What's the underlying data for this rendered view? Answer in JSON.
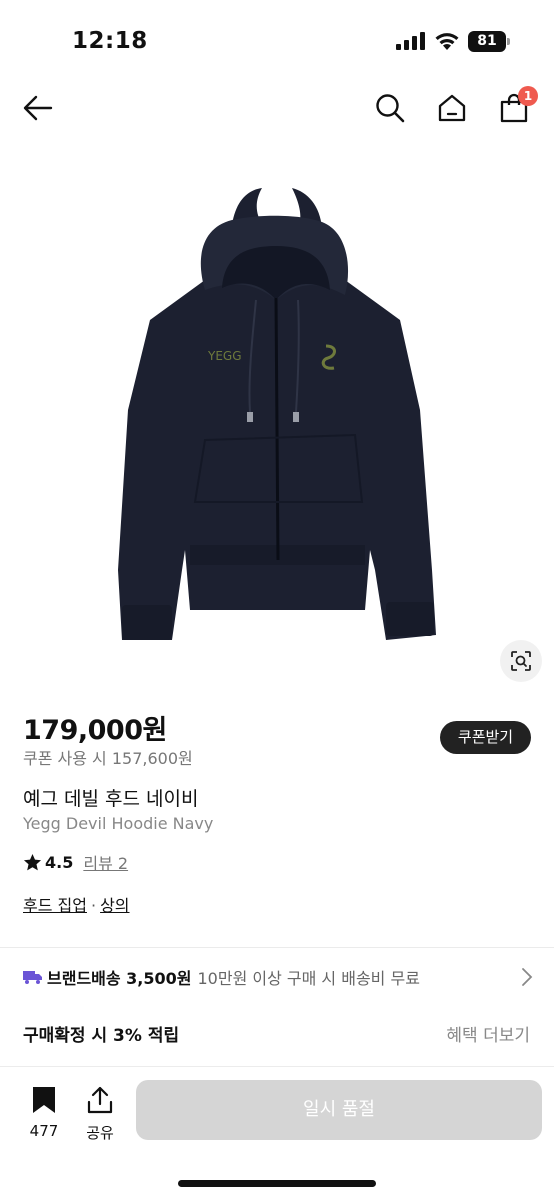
{
  "status_bar": {
    "time": "12:18",
    "battery": "81"
  },
  "nav": {
    "icons": [
      "back-arrow-icon",
      "search-icon",
      "home-icon",
      "shopping-bag-icon"
    ],
    "cart_count": "1"
  },
  "product": {
    "image_logo_text": "YEGG",
    "price": "179,000원",
    "coupon_price": "쿠폰 사용 시 157,600원",
    "coupon_button": "쿠폰받기",
    "name_ko": "예그 데빌 후드 네이비",
    "name_en": "Yegg Devil Hoodie Navy",
    "rating": "4.5",
    "review": "리뷰 2",
    "category_1": "후드 집업",
    "category_sep": "·",
    "category_2": "상의"
  },
  "shipping": {
    "title": "브랜드배송 3,500원",
    "note": "10만원 이상 구매 시 배송비 무료"
  },
  "points": {
    "title": "구매확정 시 3% 적립",
    "link": "혜택 더보기"
  },
  "bottom": {
    "bookmark_count": "477",
    "share_label": "공유",
    "soldout_label": "일시 품절"
  },
  "colors": {
    "hoodie": "#1c2030",
    "badge": "#ef5a4f",
    "shipping_icon": "#6b55d6",
    "disabled_button": "#d5d5d5"
  }
}
